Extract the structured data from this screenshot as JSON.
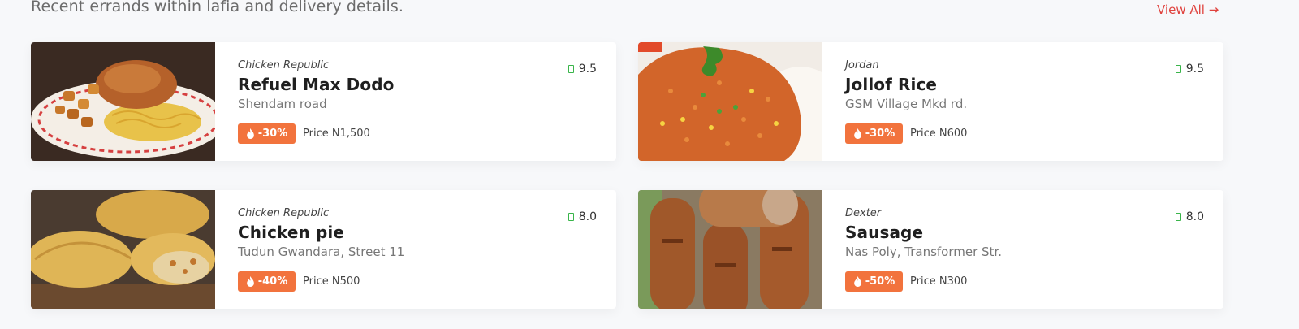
{
  "header": {
    "subtitle": "Recent errands within lafia and delivery details.",
    "view_all": "View All →"
  },
  "cards": [
    {
      "vendor": "Chicken Republic",
      "name": "Refuel Max Dodo",
      "address": "Shendam road",
      "discount": "-30%",
      "price": "Price N1,500",
      "rating": "9.5",
      "image": "rice-spaghetti-chicken"
    },
    {
      "vendor": "Jordan",
      "name": "Jollof Rice",
      "address": "GSM Village Mkd rd.",
      "discount": "-30%",
      "price": "Price N600",
      "rating": "9.5",
      "image": "jollof-rice"
    },
    {
      "vendor": "Chicken Republic",
      "name": "Chicken pie",
      "address": "Tudun Gwandara, Street 11",
      "discount": "-40%",
      "price": "Price N500",
      "rating": "8.0",
      "image": "meat-pie"
    },
    {
      "vendor": "Dexter",
      "name": "Sausage",
      "address": "Nas Poly, Transformer Str.",
      "discount": "-50%",
      "price": "Price N300",
      "rating": "8.0",
      "image": "sausages"
    }
  ],
  "colors": {
    "accent": "#f2733d",
    "link": "#e0433e",
    "rating": "#39b54a"
  }
}
